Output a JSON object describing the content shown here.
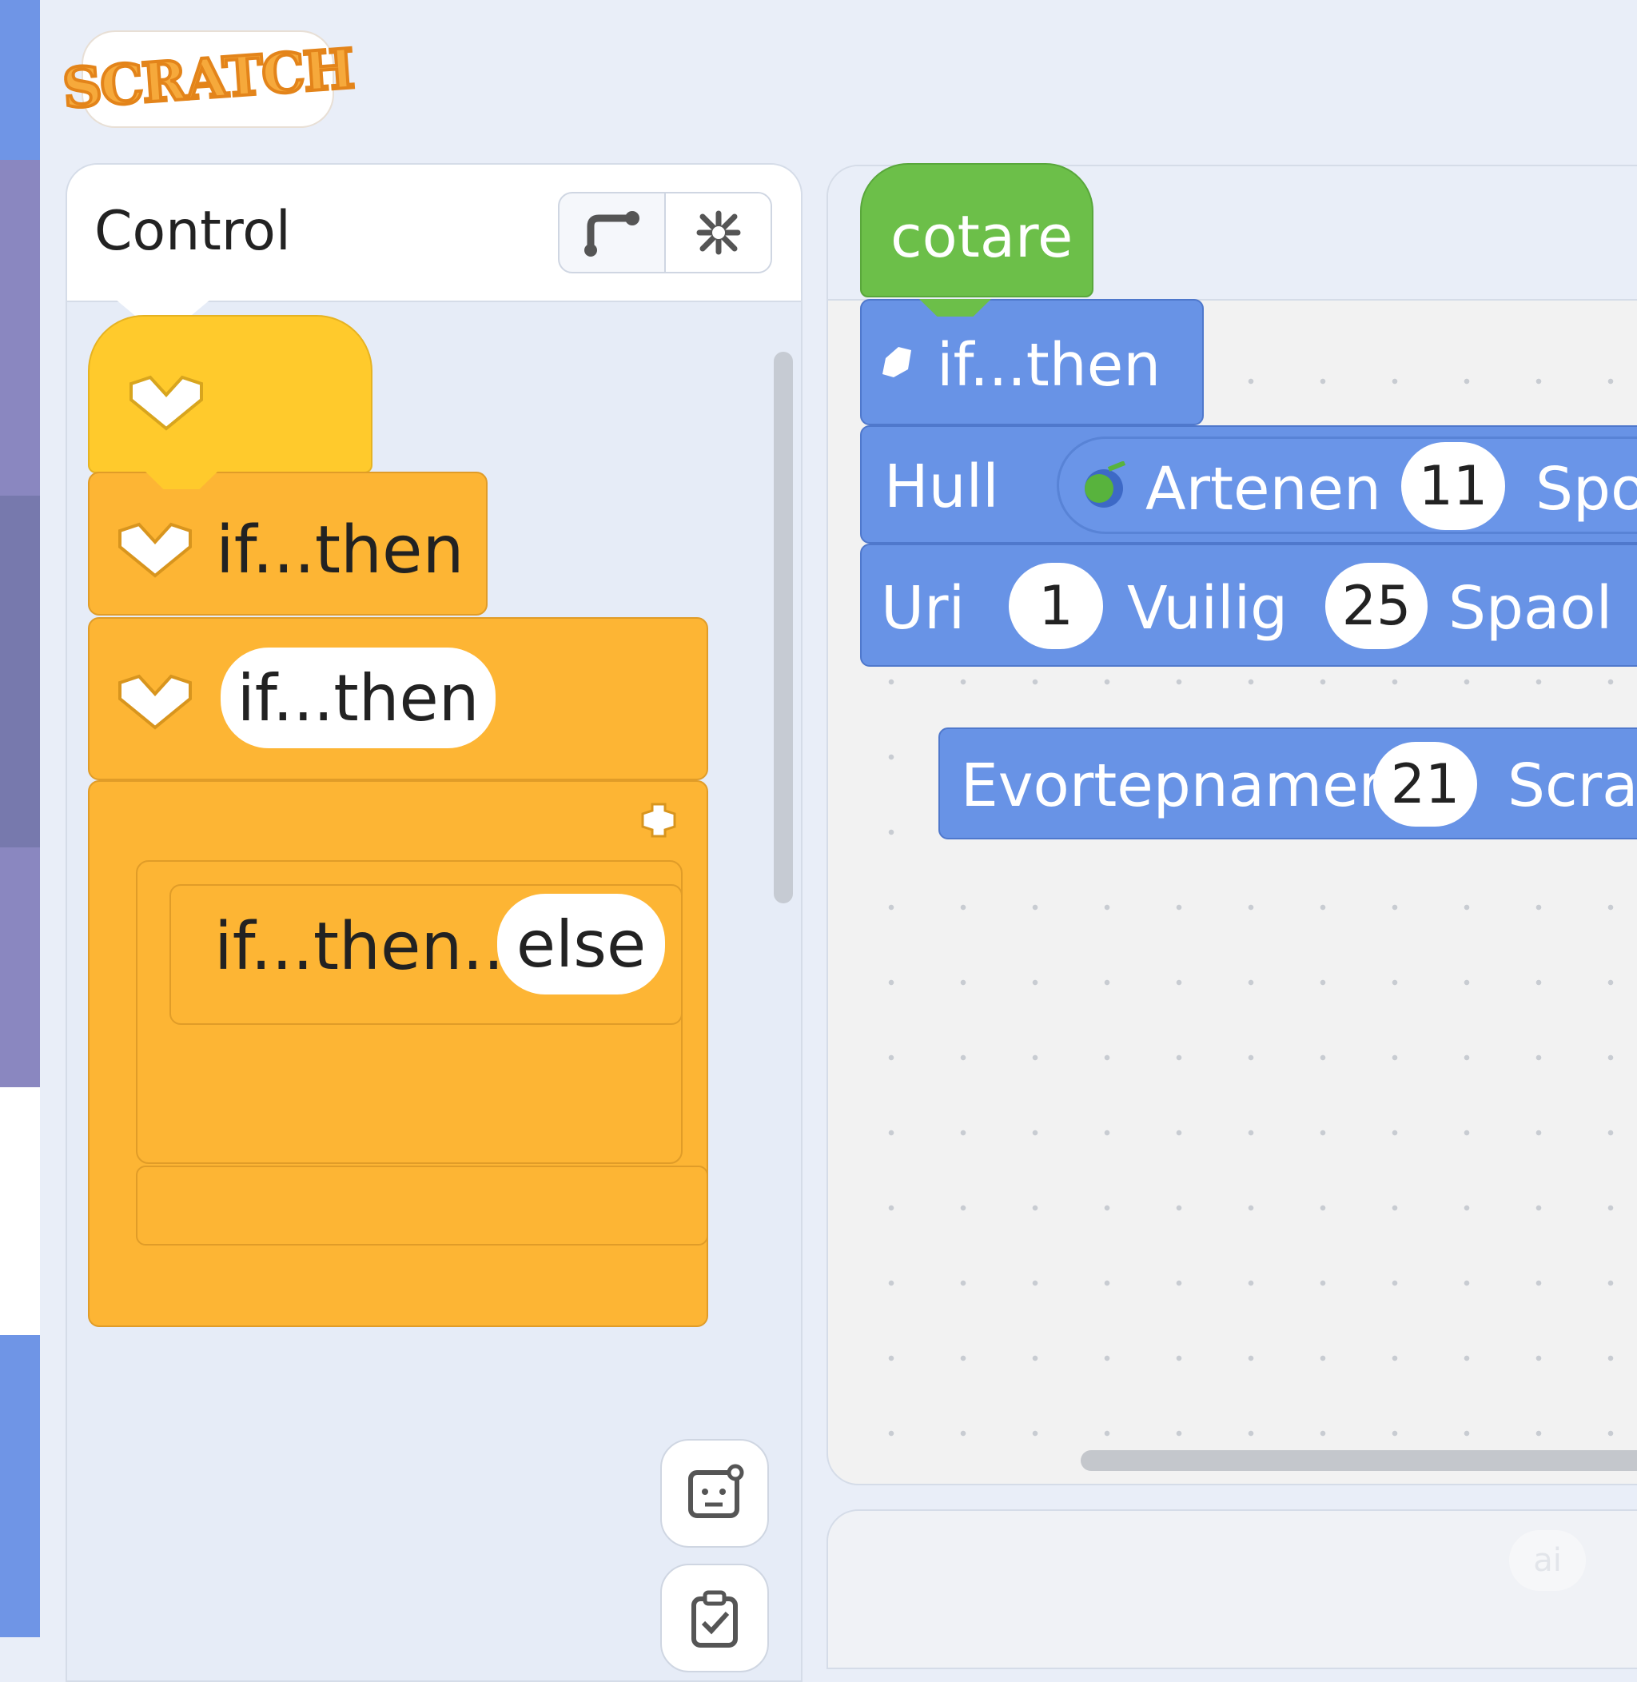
{
  "app": {
    "logo_text": "SCRATCH"
  },
  "palette": {
    "category": "Control",
    "blocks": {
      "if_then_1": "if...then",
      "if_then_2": "if...then",
      "if_then_else_prefix": "if...then...",
      "if_then_else_suffix": "else"
    }
  },
  "script": {
    "hat_label": "cotare",
    "if_then": "if...then",
    "row1": {
      "label": "Hull",
      "reporter": "Artenen",
      "value": "11",
      "tail": "Spo"
    },
    "row2": {
      "label": "Uri",
      "value1": "1",
      "label2": "Vuilig",
      "value2": "25",
      "tail": "Spaol"
    },
    "row3": {
      "label": "Evortepnamer",
      "value": "21",
      "tail": "Scrat"
    }
  },
  "stage": {
    "badge": "ai"
  },
  "colors": {
    "control": "#fdb534",
    "events": "#ffca2c",
    "motion": "#6893e6",
    "hat": "#6cbf49"
  },
  "icons": [
    "route-icon",
    "close-icon",
    "sprite-icon",
    "checklist-icon",
    "chevron-down-icon",
    "flag-icon",
    "gear-icon"
  ]
}
